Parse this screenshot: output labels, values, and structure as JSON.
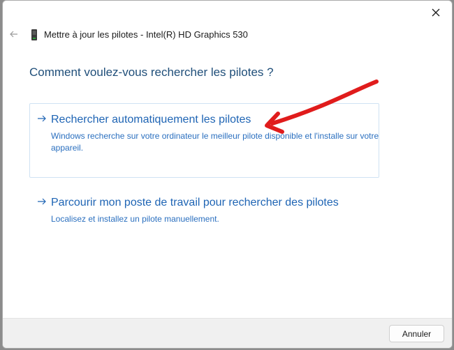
{
  "window": {
    "title": "Mettre à jour les pilotes - Intel(R) HD Graphics 530"
  },
  "heading": "Comment voulez-vous rechercher les pilotes ?",
  "options": [
    {
      "title": "Rechercher automatiquement les pilotes",
      "description": "Windows recherche sur votre ordinateur le meilleur pilote disponible et l'installe sur votre appareil."
    },
    {
      "title": "Parcourir mon poste de travail pour rechercher des pilotes",
      "description": "Localisez et installez un pilote manuellement."
    }
  ],
  "footer": {
    "cancel_label": "Annuler"
  },
  "icons": {
    "close": "close-icon",
    "back": "back-arrow-icon",
    "device": "graphics-card-icon",
    "option_arrow": "arrow-right-icon"
  },
  "colors": {
    "heading": "#1f4e79",
    "link": "#1e64b4",
    "annotation": "#e01c1c"
  }
}
